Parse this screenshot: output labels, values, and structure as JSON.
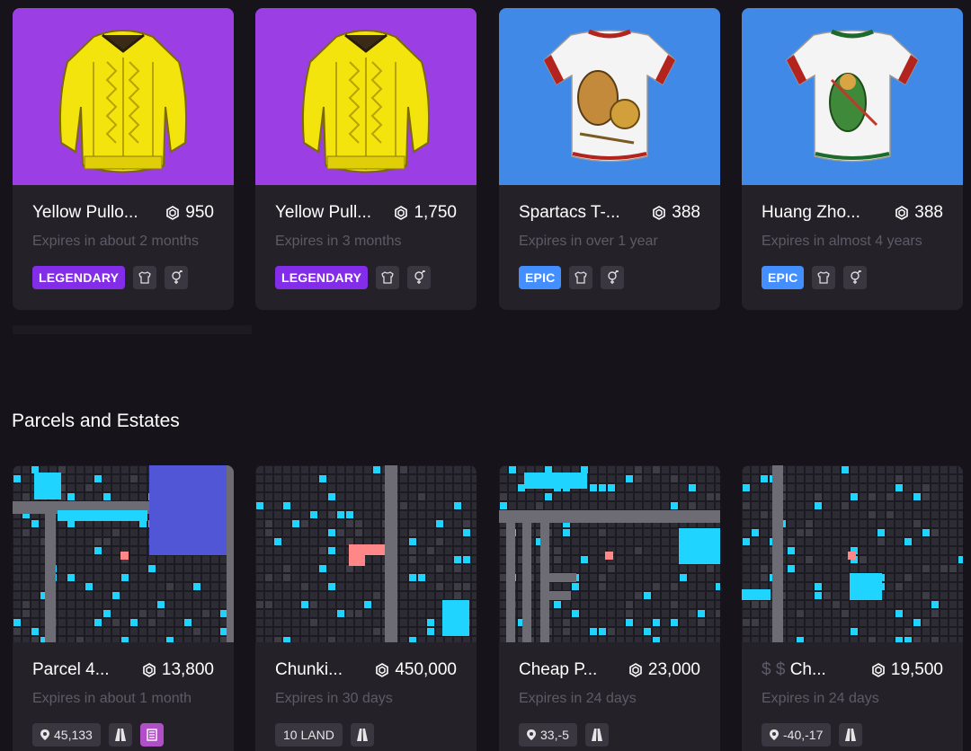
{
  "wearables": [
    {
      "title": "Yellow Pullo...",
      "price": "950",
      "expires": "Expires in about 2 months",
      "rarity": "LEGENDARY",
      "rarity_color": "#842de8",
      "icons": [
        "upper-body-icon",
        "unisex-icon"
      ]
    },
    {
      "title": "Yellow Pull...",
      "price": "1,750",
      "expires": "Expires in 3 months",
      "rarity": "LEGENDARY",
      "rarity_color": "#842de8",
      "icons": [
        "upper-body-icon",
        "unisex-icon"
      ]
    },
    {
      "title": "Spartacs T-...",
      "price": "388",
      "expires": "Expires in over 1 year",
      "rarity": "EPIC",
      "rarity_color": "#438fff",
      "icons": [
        "upper-body-icon",
        "unisex-icon"
      ]
    },
    {
      "title": "Huang Zho...",
      "price": "388",
      "expires": "Expires in almost 4 years",
      "rarity": "EPIC",
      "rarity_color": "#438fff",
      "icons": [
        "upper-body-icon",
        "unisex-icon"
      ]
    }
  ],
  "section": {
    "title": "Parcels and Estates"
  },
  "lands": [
    {
      "title": "Parcel 4...",
      "price": "13,800",
      "expires": "Expires in about 1 month",
      "tag": "45,133",
      "tag_icon": "pin-icon",
      "icons": [
        "road-icon",
        "district-icon"
      ]
    },
    {
      "title": "Chunki...",
      "price": "450,000",
      "expires": "Expires in 30 days",
      "tag": "10 LAND",
      "tag_icon": "",
      "icons": [
        "road-icon"
      ]
    },
    {
      "title": "Cheap P...",
      "price": "23,000",
      "expires": "Expires in 24 days",
      "tag": "33,-5",
      "tag_icon": "pin-icon",
      "icons": [
        "road-icon"
      ]
    },
    {
      "title": "$ $ Ch...",
      "title_prefix": "$ $",
      "title_rest": "Ch...",
      "price": "19,500",
      "expires": "Expires in 24 days",
      "tag": "-40,-17",
      "tag_icon": "pin-icon",
      "icons": [
        "road-icon"
      ]
    }
  ],
  "colors": {
    "legendary": "#842de8",
    "epic": "#438fff",
    "district": "#b04fc7",
    "parcel_highlight": "#ff8787",
    "map_cyan": "#1fd5ff"
  }
}
